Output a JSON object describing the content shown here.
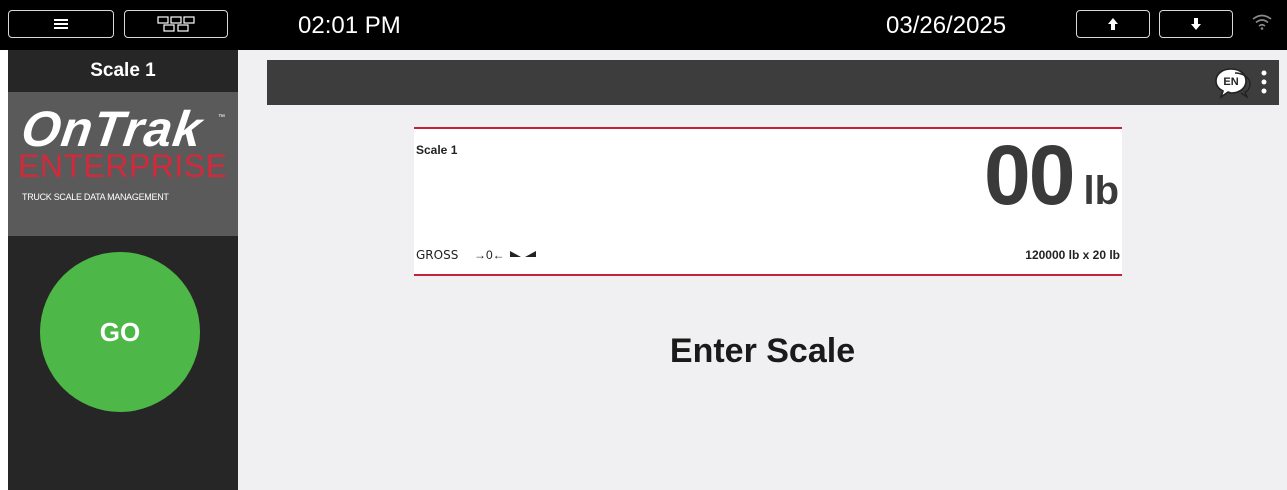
{
  "topbar": {
    "menu_icon": "hamburger-icon",
    "grid_icon": "grid-icon",
    "time": "02:01 PM",
    "date": "03/26/2025",
    "up_icon": "arrow-up-icon",
    "down_icon": "arrow-down-icon",
    "wifi_icon": "wifi-icon"
  },
  "sidebar": {
    "scale_title": "Scale 1",
    "logo": {
      "brand": "OnTrak",
      "tm": "™",
      "sub": "ENTERPRISE",
      "tagline": "TRUCK SCALE DATA MANAGEMENT"
    },
    "go_label": "GO"
  },
  "header": {
    "language_icon": "language-icon",
    "language_code": "EN",
    "more_icon": "kebab-menu-icon"
  },
  "display": {
    "scale_name": "Scale 1",
    "weight": "00",
    "unit": "lb",
    "mode": "GROSS",
    "zero_indicator": "→0←",
    "motion_icon": "motion-indicator-icon",
    "capacity": "120000 lb x 20 lb"
  },
  "status_message": "Enter Scale",
  "colors": {
    "topbar": "#000000",
    "sidebar": "#262626",
    "logo_bg": "#5a5a5a",
    "brand_red": "#d3293a",
    "go_green": "#4db848",
    "display_border": "#c4203a",
    "main_bg": "#f0f0f2"
  }
}
